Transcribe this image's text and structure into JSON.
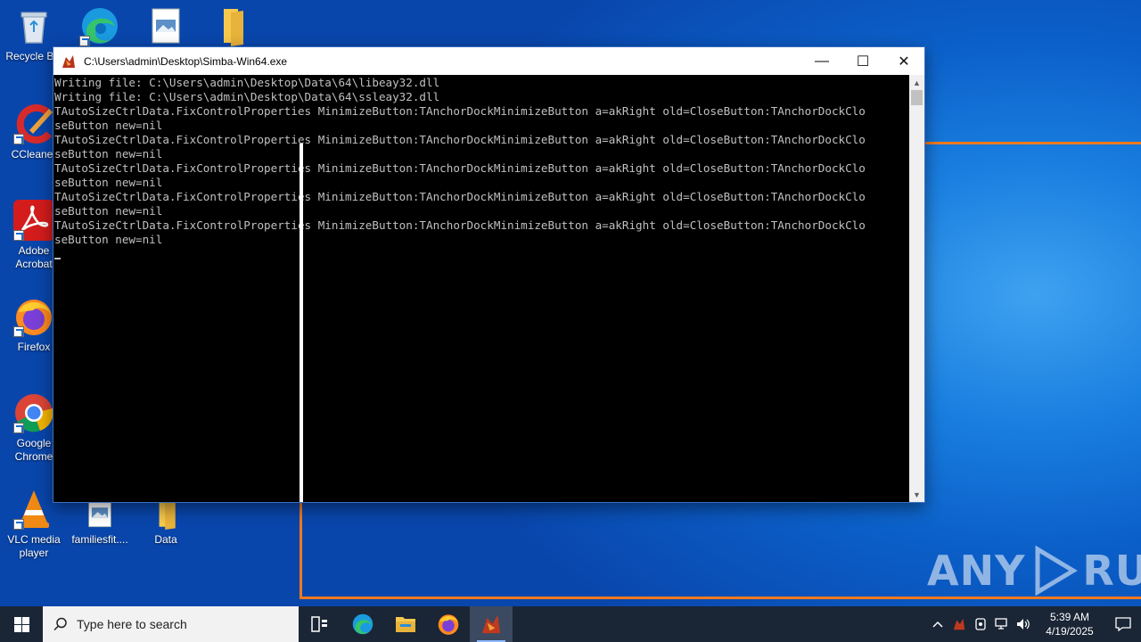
{
  "desktop": {
    "icons": [
      {
        "label": "Recycle Bin"
      },
      {
        "label": "CCleaner"
      },
      {
        "label": "Adobe Acrobat"
      },
      {
        "label": "Firefox"
      },
      {
        "label": "Google Chrome"
      },
      {
        "label": "VLC media player"
      },
      {
        "label": "familiesfit...."
      },
      {
        "label": "Data"
      }
    ]
  },
  "window": {
    "title": "C:\\Users\\admin\\Desktop\\Simba-Win64.exe",
    "minimize_glyph": "—",
    "maximize_glyph": "☐",
    "close_glyph": "✕",
    "console_lines": [
      "Writing file: C:\\Users\\admin\\Desktop\\Data\\64\\libeay32.dll",
      "Writing file: C:\\Users\\admin\\Desktop\\Data\\64\\ssleay32.dll",
      "TAutoSizeCtrlData.FixControlProperties MinimizeButton:TAnchorDockMinimizeButton a=akRight old=CloseButton:TAnchorDockClo",
      "seButton new=nil",
      "TAutoSizeCtrlData.FixControlProperties MinimizeButton:TAnchorDockMinimizeButton a=akRight old=CloseButton:TAnchorDockClo",
      "seButton new=nil",
      "TAutoSizeCtrlData.FixControlProperties MinimizeButton:TAnchorDockMinimizeButton a=akRight old=CloseButton:TAnchorDockClo",
      "seButton new=nil",
      "TAutoSizeCtrlData.FixControlProperties MinimizeButton:TAnchorDockMinimizeButton a=akRight old=CloseButton:TAnchorDockClo",
      "seButton new=nil",
      "TAutoSizeCtrlData.FixControlProperties MinimizeButton:TAnchorDockMinimizeButton a=akRight old=CloseButton:TAnchorDockClo",
      "seButton new=nil"
    ]
  },
  "watermark": {
    "left": "ANY",
    "right": "RUN"
  },
  "taskbar": {
    "search_placeholder": "Type here to search",
    "clock_time": "5:39 AM",
    "clock_date": "4/19/2025",
    "apps": [
      "task-view",
      "edge",
      "file-explorer",
      "firefox",
      "simba"
    ]
  },
  "colors": {
    "accent_orange": "#f07a1e",
    "console_bg": "#000000",
    "console_text": "#c0c0c0",
    "taskbar_bg": "#1a2535"
  }
}
